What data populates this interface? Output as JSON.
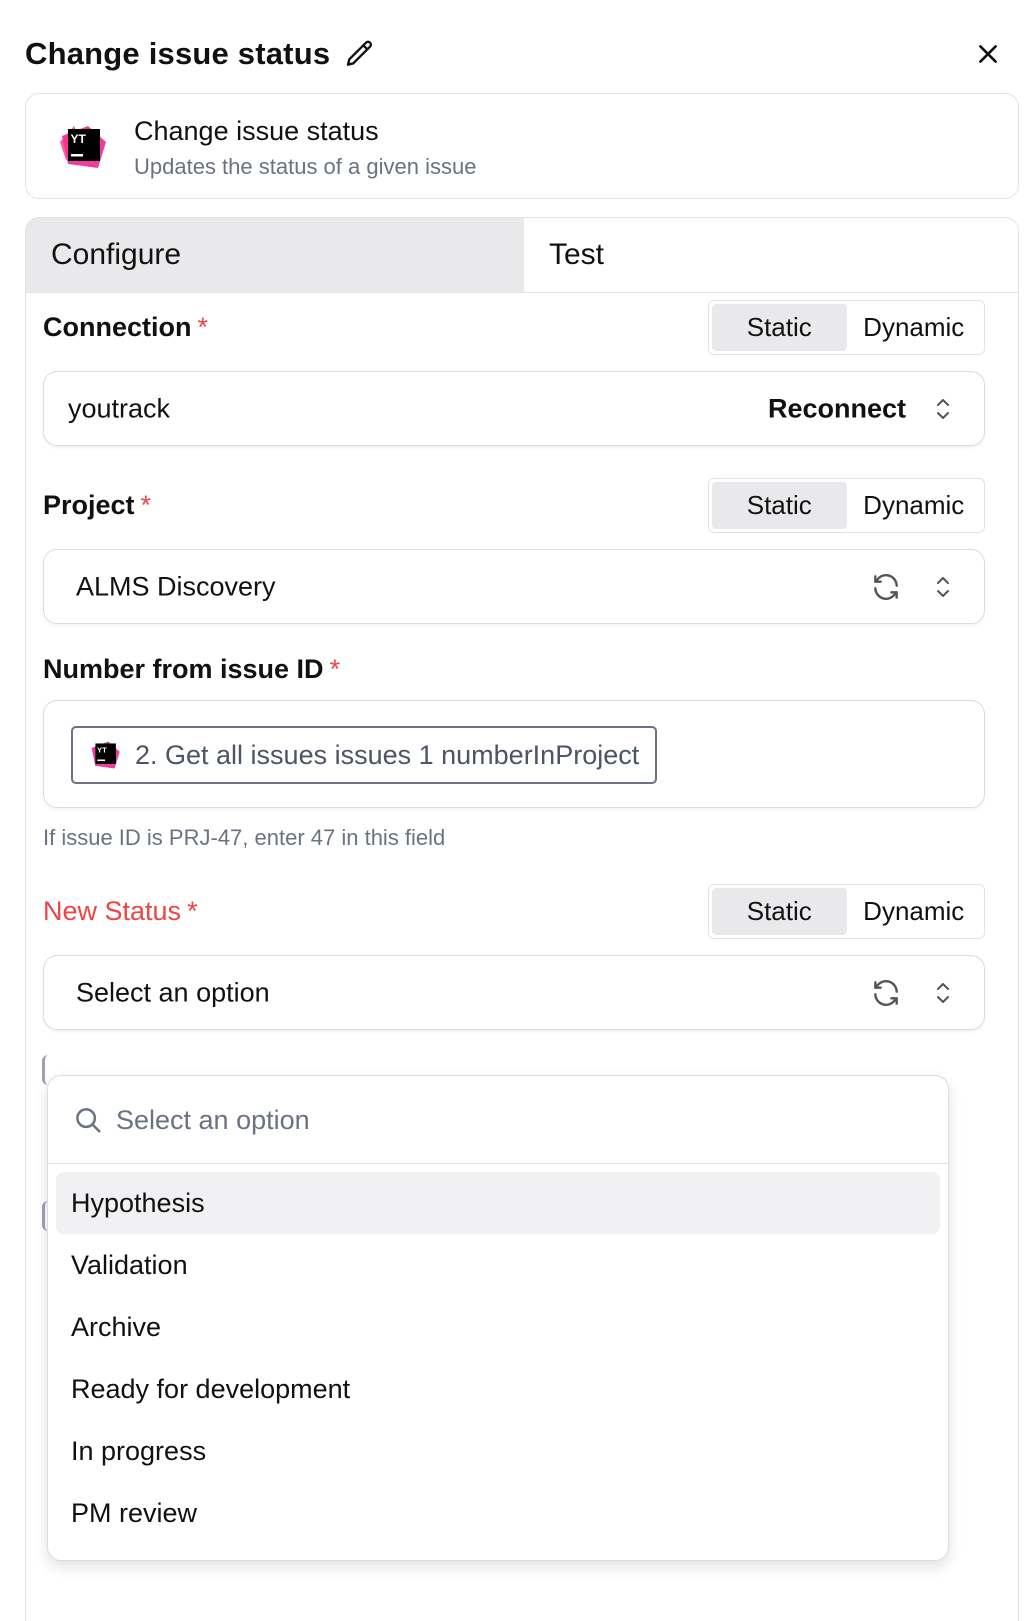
{
  "header": {
    "title": "Change issue status"
  },
  "summary": {
    "title": "Change issue status",
    "description": "Updates the status of a given issue",
    "logo_text": "YT"
  },
  "tabs": [
    {
      "label": "Configure",
      "active": true
    },
    {
      "label": "Test",
      "active": false
    }
  ],
  "toggle": {
    "static": "Static",
    "dynamic": "Dynamic",
    "selected": "Static"
  },
  "fields": {
    "connection": {
      "label": "Connection",
      "required": "*",
      "value": "youtrack",
      "action": "Reconnect"
    },
    "project": {
      "label": "Project",
      "required": "*",
      "value": "ALMS Discovery"
    },
    "number": {
      "label": "Number from issue ID",
      "required": "*",
      "chip": "2. Get all issues issues 1 numberInProject",
      "hint": "If issue ID is PRJ-47, enter 47 in this field"
    },
    "status": {
      "label": "New Status",
      "required": "*",
      "value": "Select an option",
      "state": "error"
    }
  },
  "dropdown": {
    "search_placeholder": "Select an option",
    "options": [
      "Hypothesis",
      "Validation",
      "Archive",
      "Ready for development",
      "In progress",
      "PM review"
    ],
    "highlighted": "Hypothesis"
  },
  "colors": {
    "accent": "#ef4444",
    "tab_active": "#e9e9ec",
    "logo_pink": "#ee3c9f"
  }
}
